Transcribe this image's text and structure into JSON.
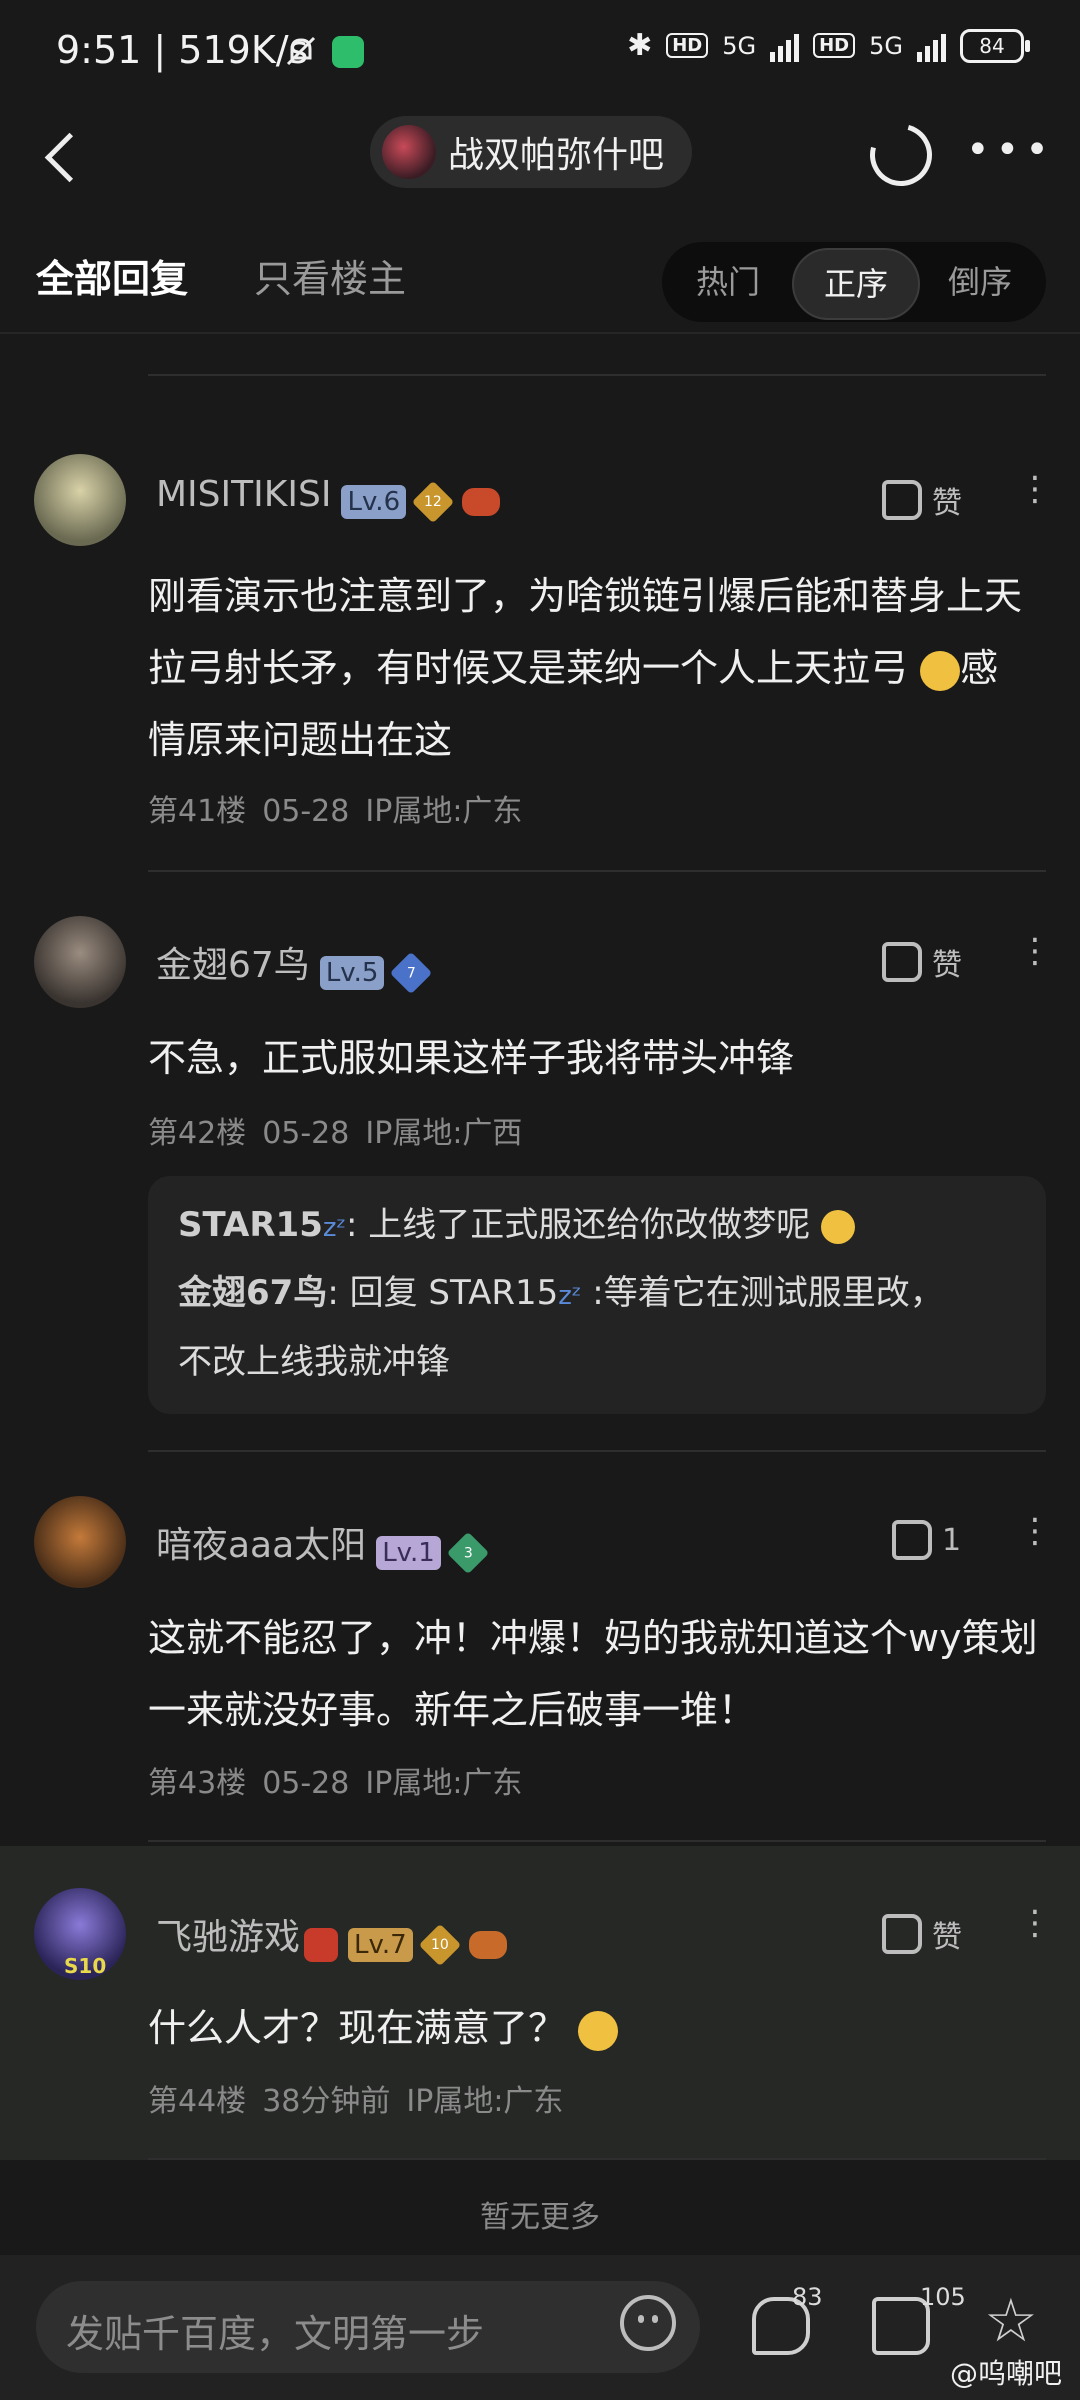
{
  "status_bar": {
    "time": "9:51 | 519K/s",
    "hd1": "HD",
    "net1": "5G",
    "hd2": "HD",
    "net2": "5G",
    "battery": "84"
  },
  "nav": {
    "forum_name": "战双帕弥什吧"
  },
  "tabs": {
    "all_replies": "全部回复",
    "op_only": "只看楼主",
    "sort_hot": "热门",
    "sort_asc": "正序",
    "sort_desc": "倒序"
  },
  "posts": [
    {
      "username": "MISITIKISI",
      "level": "Lv.6",
      "badge": "12",
      "badge2": "2",
      "like_label": "赞",
      "content_lines": [
        "刚看演示也注意到了，为啥锁链引爆后能和替身上天",
        "拉弓射长矛，有时候又是莱纳一个人上天拉弓",
        "感",
        "情原来问题出在这"
      ],
      "floor": "第41楼",
      "date": "05-28",
      "ip": "IP属地:广东"
    },
    {
      "username": "金翅67鸟",
      "level": "Lv.5",
      "badge": "7",
      "like_label": "赞",
      "content_lines": [
        "不急，正式服如果这样子我将带头冲锋"
      ],
      "floor": "第42楼",
      "date": "05-28",
      "ip": "IP属地:广西",
      "replies": [
        {
          "author": "STAR15",
          "text": ": 上线了正式服还给你改做梦呢"
        },
        {
          "author": "金翅67鸟",
          "text": ": 回复 STAR15",
          "text2": " :等着它在测试服里改，",
          "text3": "不改上线我就冲锋"
        }
      ]
    },
    {
      "username": "暗夜aaa太阳",
      "level": "Lv.1",
      "badge": "3",
      "like_label": "1",
      "content_lines": [
        "这就不能忍了，冲！冲爆！妈的我就知道这个wy策划",
        "一来就没好事。新年之后破事一堆！"
      ],
      "floor": "第43楼",
      "date": "05-28",
      "ip": "IP属地:广东"
    },
    {
      "username": "飞驰游戏",
      "level": "Lv.7",
      "badge": "10",
      "like_label": "赞",
      "avatar_label": "S10",
      "content_lines": [
        "什么人才？现在满意了？"
      ],
      "floor": "第44楼",
      "date": "38分钟前",
      "ip": "IP属地:广东"
    }
  ],
  "no_more": "暂无更多",
  "bottom_bar": {
    "placeholder": "发贴千百度，文明第一步",
    "comment_count": "83",
    "like_count": "105",
    "watermark": "@呜嘲吧"
  },
  "colors": {
    "background": "#191919",
    "highlight_row": "#262826",
    "lv6": "#8aa0c8",
    "lv5": "#8aa0c8",
    "lv1": "#b6a7d6",
    "lv7": "#c89a4a"
  }
}
